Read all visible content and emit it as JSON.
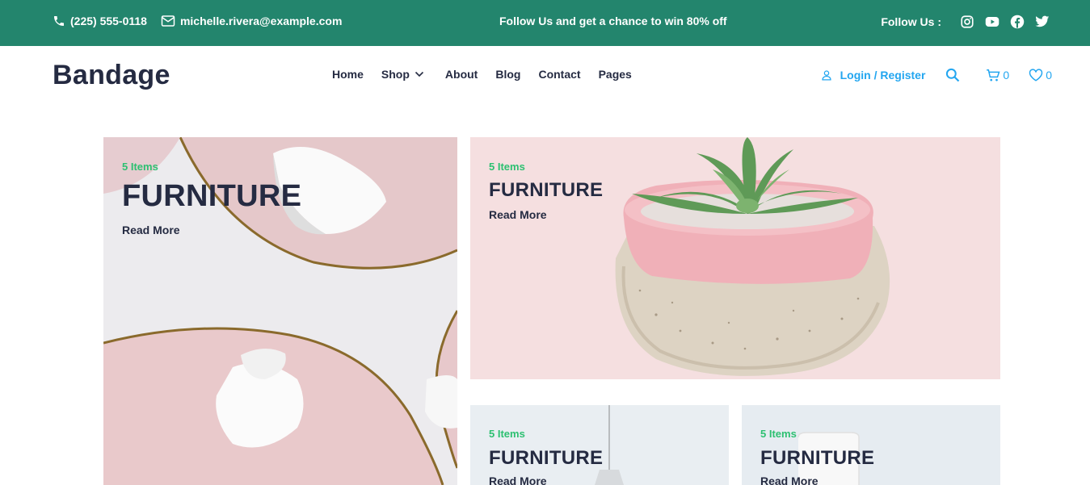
{
  "topbar": {
    "phone": "(225) 555-0118",
    "email": "michelle.rivera@example.com",
    "promo": "Follow Us  and get a chance to win 80% off",
    "follow_label": "Follow Us :",
    "social": [
      "instagram-icon",
      "youtube-icon",
      "facebook-icon",
      "twitter-icon"
    ]
  },
  "navbar": {
    "brand": "Bandage",
    "menu": [
      "Home",
      "Shop",
      "About",
      "Blog",
      "Contact",
      "Pages"
    ],
    "login": "Login / Register",
    "cart_count": "0",
    "wishlist_count": "0"
  },
  "cards": [
    {
      "count": "5 Items",
      "title": "FURNITURE",
      "link": "Read More"
    },
    {
      "count": "5 Items",
      "title": "FURNITURE",
      "link": "Read More"
    },
    {
      "count": "5 Items",
      "title": "FURNITURE",
      "link": "Read More"
    },
    {
      "count": "5 Items",
      "title": "FURNITURE",
      "link": "Read More"
    }
  ],
  "colors": {
    "topbar_bg": "#23856D",
    "accent_blue": "#23A6F0",
    "accent_green": "#2DC071",
    "text_dark": "#252B42"
  }
}
